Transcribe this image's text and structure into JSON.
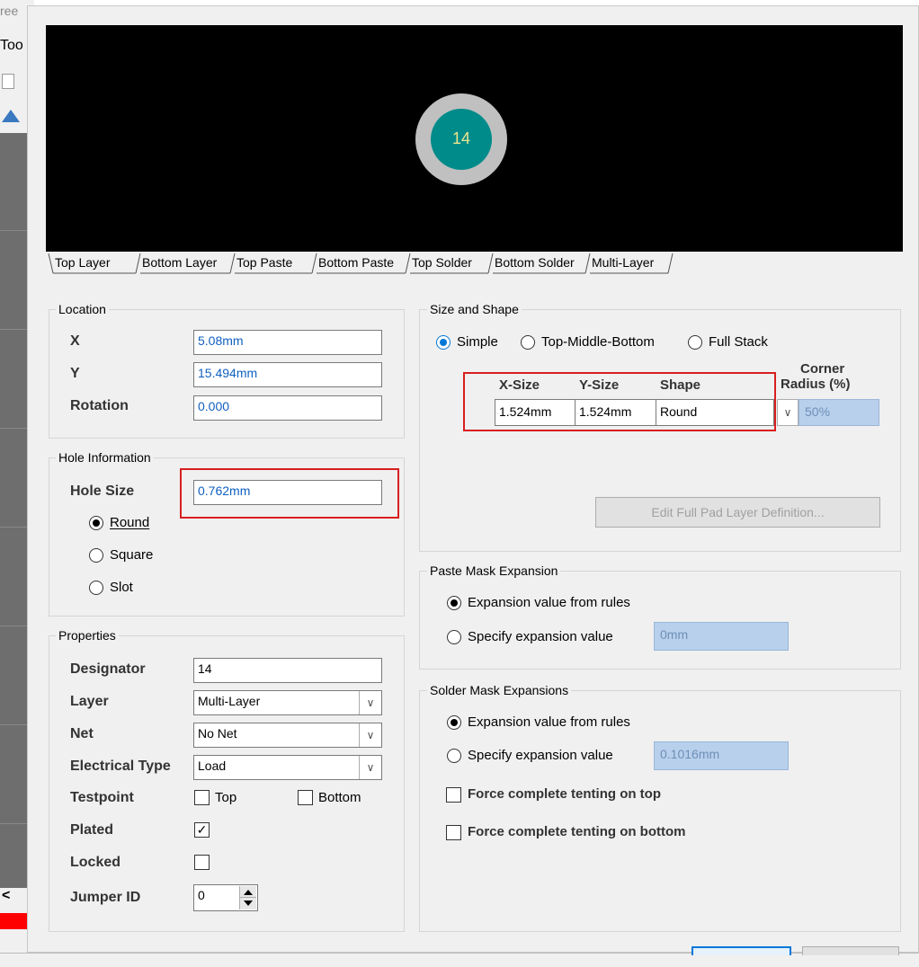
{
  "background_app": {
    "title_fragment": "ree",
    "menu_fragment": "Too",
    "scroll_arrow": "<"
  },
  "preview": {
    "pad_label": "14",
    "outer_color": "#c0c0c0",
    "inner_color": "#008b8b",
    "label_color": "#f0e68c",
    "layer_tabs": [
      "Top Layer",
      "Bottom Layer",
      "Top Paste",
      "Bottom Paste",
      "Top Solder",
      "Bottom Solder",
      "Multi-Layer"
    ]
  },
  "location": {
    "title": "Location",
    "x_label": "X",
    "x_value": "5.08mm",
    "y_label": "Y",
    "y_value": "15.494mm",
    "rotation_label": "Rotation",
    "rotation_value": "0.000"
  },
  "hole": {
    "title": "Hole Information",
    "size_label": "Hole Size",
    "size_value": "0.762mm",
    "round_label": "Round",
    "square_label": "Square",
    "slot_label": "Slot",
    "selected": "Round"
  },
  "properties": {
    "title": "Properties",
    "designator_label": "Designator",
    "designator_value": "14",
    "layer_label": "Layer",
    "layer_value": "Multi-Layer",
    "net_label": "Net",
    "net_value": "No Net",
    "electrical_label": "Electrical Type",
    "electrical_value": "Load",
    "testpoint_label": "Testpoint",
    "testpoint_top": "Top",
    "testpoint_bottom": "Bottom",
    "plated_label": "Plated",
    "plated_checked": true,
    "locked_label": "Locked",
    "locked_checked": false,
    "jumper_label": "Jumper ID",
    "jumper_value": "0"
  },
  "size_shape": {
    "title": "Size and Shape",
    "mode_simple": "Simple",
    "mode_tmb": "Top-Middle-Bottom",
    "mode_full": "Full Stack",
    "selected_mode": "Simple",
    "col_x": "X-Size",
    "col_y": "Y-Size",
    "col_shape": "Shape",
    "col_corner_1": "Corner",
    "col_corner_2": "Radius (%)",
    "x_size": "1.524mm",
    "y_size": "1.524mm",
    "shape": "Round",
    "corner_radius": "50%",
    "edit_button": "Edit Full Pad Layer Definition..."
  },
  "paste_mask": {
    "title": "Paste Mask Expansion",
    "option_rules": "Expansion value from rules",
    "option_specify": "Specify expansion value",
    "value": "0mm",
    "selected": "rules"
  },
  "solder_mask": {
    "title": "Solder Mask Expansions",
    "option_rules": "Expansion value from rules",
    "option_specify": "Specify expansion value",
    "value": "0.1016mm",
    "selected": "rules",
    "tent_top": "Force complete tenting on top",
    "tent_bottom": "Force complete tenting on bottom"
  },
  "colors": {
    "highlight": "#d81f1f",
    "link_blue": "#1060c0",
    "accent": "#0078d7"
  }
}
